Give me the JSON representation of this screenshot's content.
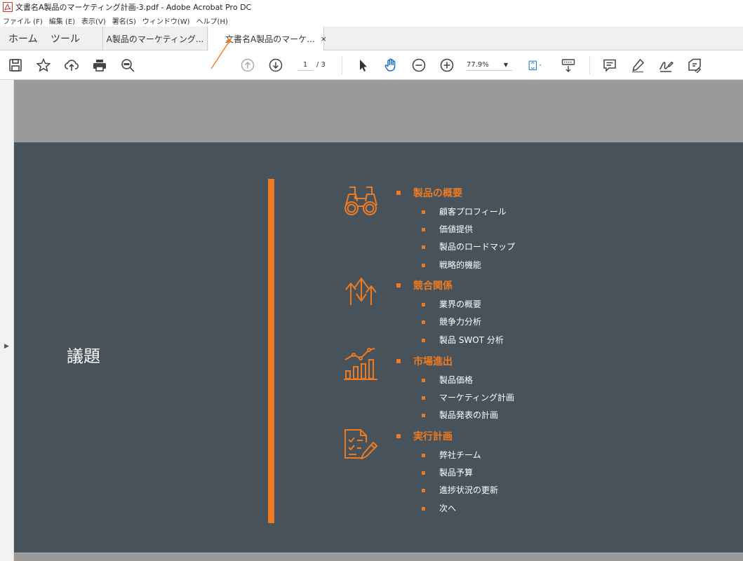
{
  "window": {
    "title": "文書名A製品のマーケティング計画-3.pdf - Adobe Acrobat Pro DC"
  },
  "menu": [
    "ファイル (F)",
    "編集 (E)",
    "表示(V)",
    "署名(S)",
    "ウィンドウ(W)",
    "ヘルプ(H)"
  ],
  "tabs": {
    "home": "ホーム",
    "tools": "ツール",
    "doc1": "A製品のマーケティング...",
    "doc2": "文書名A製品のマーケ...",
    "close": "×"
  },
  "toolbar": {
    "page_current": "1",
    "page_total": "/ 3",
    "zoom": "77.9%",
    "icons": [
      "save-icon",
      "star-icon",
      "cloud-upload-icon",
      "print-icon",
      "search-icon",
      "arrow-up-icon",
      "arrow-down-icon",
      "cursor-icon",
      "hand-icon",
      "zoom-out-icon",
      "zoom-in-icon",
      "page-fit-icon",
      "scroll-icon",
      "comment-icon",
      "highlight-icon",
      "sign-icon",
      "stamp-icon"
    ]
  },
  "annotation": {
    "color": "#ee7b22"
  },
  "slide": {
    "title": "議題",
    "accent_color": "#ee7b22",
    "background_color": "#47525a",
    "sections": [
      {
        "icon": "binoculars-icon",
        "title": "製品の概要",
        "items": [
          "顧客プロフィール",
          "価値提供",
          "製品のロードマップ",
          "戦略的機能"
        ]
      },
      {
        "icon": "growth-arrows-icon",
        "title": "競合関係",
        "items": [
          "業界の概要",
          "競争力分析",
          "製品 SWOT 分析"
        ]
      },
      {
        "icon": "bar-chart-trend-icon",
        "title": "市場進出",
        "items": [
          "製品価格",
          "マーケティング計画",
          "製品発表の計画"
        ]
      },
      {
        "icon": "checklist-pen-icon",
        "title": "実行計画",
        "items": [
          "弊社チーム",
          "製品予算",
          "進捗状況の更新",
          "次へ"
        ]
      }
    ]
  }
}
